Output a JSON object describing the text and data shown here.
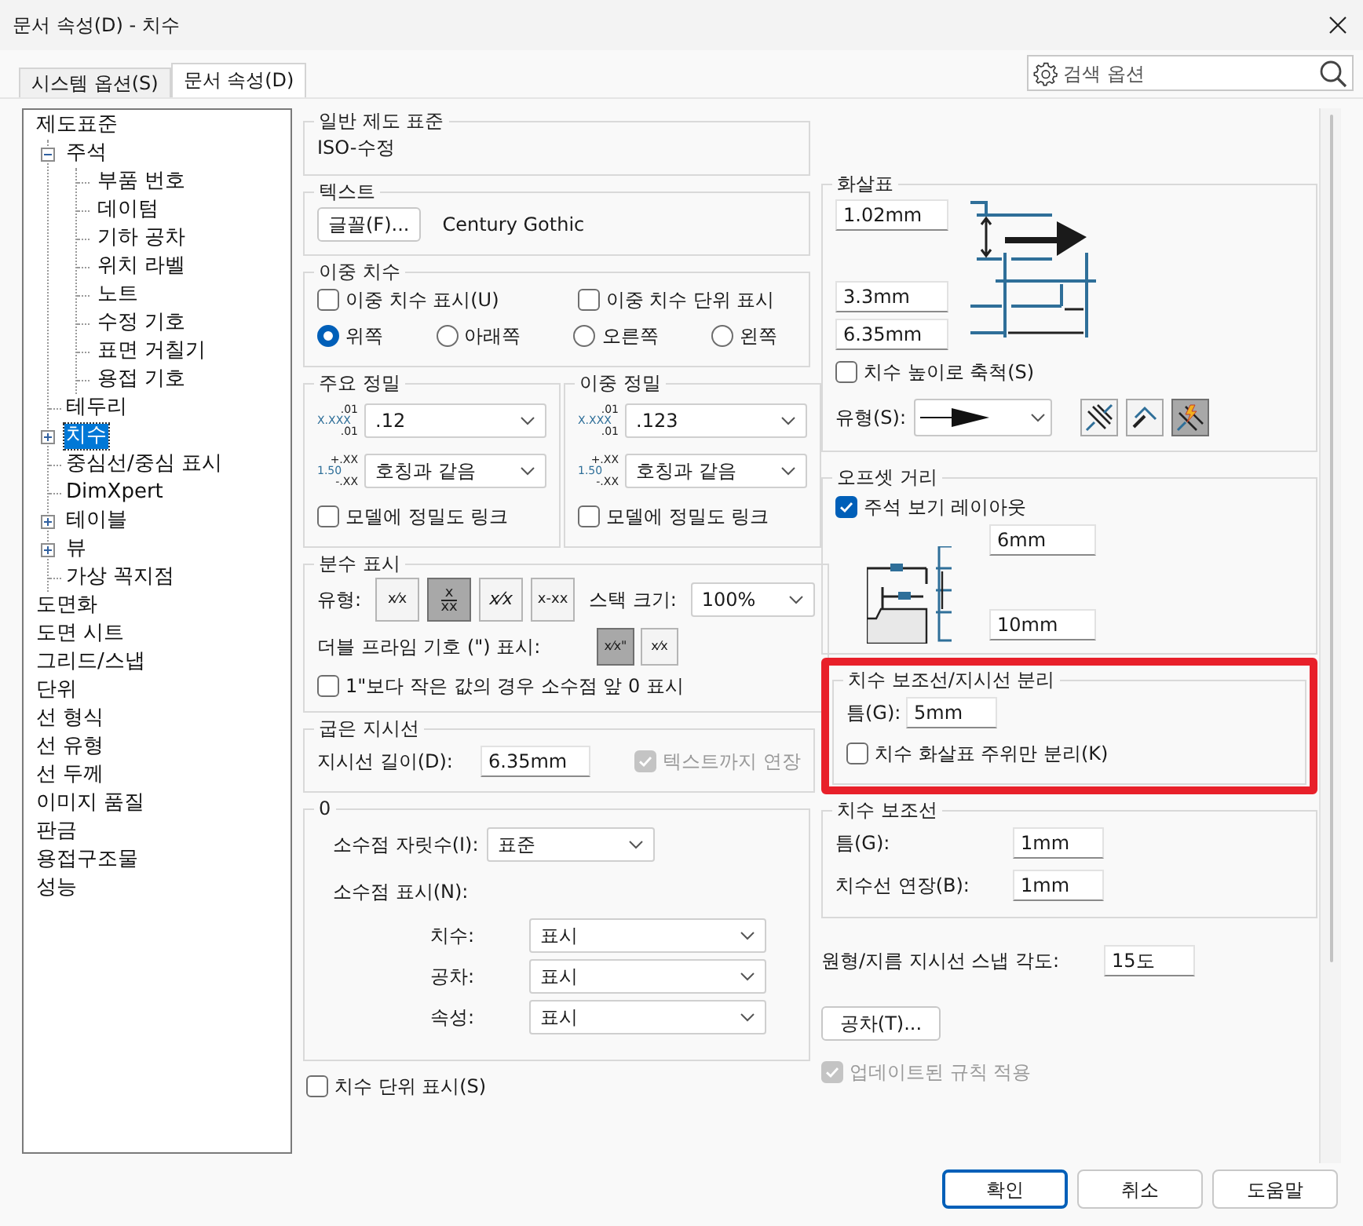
{
  "window": {
    "title": "문서 속성(D) - 치수"
  },
  "tabs": [
    {
      "label": "시스템 옵션(S)",
      "selected": false
    },
    {
      "label": "문서 속성(D)",
      "selected": true
    }
  ],
  "search": {
    "placeholder": "검색 옵션"
  },
  "tree": [
    {
      "label": "제도표준",
      "selected": false,
      "children": [
        {
          "label": "주석",
          "expanded": true,
          "selected": false,
          "children": [
            {
              "label": "부품 번호",
              "selected": false
            },
            {
              "label": "데이텀",
              "selected": false
            },
            {
              "label": "기하 공차",
              "selected": false
            },
            {
              "label": "위치 라벨",
              "selected": false
            },
            {
              "label": "노트",
              "selected": false
            },
            {
              "label": "수정 기호",
              "selected": false
            },
            {
              "label": "표면 거칠기",
              "selected": false
            },
            {
              "label": "용접 기호",
              "selected": false
            }
          ]
        },
        {
          "label": "테두리",
          "selected": false
        },
        {
          "label": "치수",
          "expanded": false,
          "selected": true
        },
        {
          "label": "중심선/중심 표시",
          "selected": false
        },
        {
          "label": "DimXpert",
          "selected": false
        },
        {
          "label": "테이블",
          "expanded": false,
          "selected": false
        },
        {
          "label": "뷰",
          "expanded": false,
          "selected": false
        },
        {
          "label": "가상 꼭지점",
          "selected": false
        }
      ]
    },
    {
      "label": "도면화",
      "selected": false
    },
    {
      "label": "도면 시트",
      "selected": false
    },
    {
      "label": "그리드/스냅",
      "selected": false
    },
    {
      "label": "단위",
      "selected": false
    },
    {
      "label": "선 형식",
      "selected": false
    },
    {
      "label": "선 유형",
      "selected": false
    },
    {
      "label": "선 두께",
      "selected": false
    },
    {
      "label": "이미지 품질",
      "selected": false
    },
    {
      "label": "판금",
      "selected": false
    },
    {
      "label": "용접구조물",
      "selected": false
    },
    {
      "label": "성능",
      "selected": false
    }
  ],
  "general_standard": {
    "legend": "일반 제도 표준",
    "value": "ISO-수정"
  },
  "text": {
    "legend": "텍스트",
    "font_button": "글꼴(F)...",
    "font_name": "Century Gothic"
  },
  "dual_dimension": {
    "legend": "이중 치수",
    "checkboxes": [
      {
        "label": "이중 치수 표시(U)",
        "checked": false
      },
      {
        "label": "이중 치수 단위 표시",
        "checked": false
      }
    ],
    "radios": [
      {
        "label": "위쪽",
        "selected": true
      },
      {
        "label": "아래쪽",
        "selected": false
      },
      {
        "label": "오른쪽",
        "selected": false
      },
      {
        "label": "왼쪽",
        "selected": false
      }
    ]
  },
  "precision_groups": [
    {
      "legend": "주요 정밀",
      "value_icon": [
        ".01",
        "X.XXX",
        ".01"
      ],
      "value": ".12",
      "tolerance_icon": [
        "+.XX",
        "1.50",
        "-.XX"
      ],
      "tolerance": "호칭과 같음",
      "link": {
        "label": "모델에 정밀도 링크",
        "checked": false
      }
    },
    {
      "legend": "이중 정밀",
      "value_icon": [
        ".01",
        "X.XXX",
        ".01"
      ],
      "value": ".123",
      "tolerance_icon": [
        "+.XX",
        "1.50",
        "-.XX"
      ],
      "tolerance": "호칭과 같음",
      "link": {
        "label": "모델에 정밀도 링크",
        "checked": false
      }
    }
  ],
  "fraction": {
    "legend": "분수 표시",
    "style_label": "유형:",
    "styles": [
      {
        "kind": "inline",
        "label": "x⁄x",
        "selected": false
      },
      {
        "kind": "stacked",
        "top": "x",
        "bottom": "xx",
        "selected": true
      },
      {
        "kind": "diagonal",
        "label": "x⁄x",
        "selected": false
      },
      {
        "kind": "inline",
        "label": "x-xx",
        "selected": false
      }
    ],
    "stack_label": "스택 크기:",
    "stack_size": "100%",
    "prime_label": "더블 프라임 기호 (\") 표시:",
    "prime_styles": [
      {
        "label": "x⁄x\"",
        "selected": true
      },
      {
        "label": "x⁄x",
        "selected": false
      }
    ],
    "leading_zero": {
      "label": "1\"보다 작은 값의 경우 소수점 앞 0 표시",
      "checked": false
    }
  },
  "bent_leader": {
    "legend": "굽은 지시선",
    "length_label": "지시선 길이(D):",
    "length": "6.35mm",
    "extend": {
      "label": "텍스트까지 연장",
      "checked": true,
      "disabled": true
    }
  },
  "zero_group": {
    "legend": "0",
    "places_label": "소수점 자릿수(I):",
    "places": "표준",
    "display_label": "소수점 표시(N):",
    "rows": [
      {
        "label": "치수:",
        "value": "표시"
      },
      {
        "label": "공차:",
        "value": "표시"
      },
      {
        "label": "속성:",
        "value": "표시"
      }
    ]
  },
  "unit_display": {
    "label": "치수 단위 표시(S)",
    "checked": false
  },
  "arrows": {
    "legend": "화살표",
    "sizes": [
      "1.02mm",
      "3.3mm",
      "6.35mm"
    ],
    "scale": {
      "label": "치수 높이로 축척(S)",
      "checked": false
    },
    "style_label": "유형(S):",
    "placements": [
      {
        "kind": "inside",
        "selected": false
      },
      {
        "kind": "outside",
        "selected": false
      },
      {
        "kind": "smart",
        "selected": true
      }
    ]
  },
  "offset": {
    "legend": "오프셋 거리",
    "layout": {
      "label": "주석 보기 레이아웃",
      "checked": true
    },
    "values": [
      "6mm",
      "10mm"
    ]
  },
  "break": {
    "legend": "치수 보조선/지시선 분리",
    "highlighted": true,
    "gap_label": "틈(G):",
    "gap": "5mm",
    "only_arrows": {
      "label": "치수 화살표 주위만 분리(K)",
      "checked": false
    }
  },
  "extension_lines": {
    "legend": "치수 보조선",
    "gap_label": "틈(G):",
    "gap": "1mm",
    "extend_label": "치수선 연장(B):",
    "extend": "1mm"
  },
  "snap_angle": {
    "label": "원형/지름 지시선 스냅 각도:",
    "value": "15도"
  },
  "tolerance_button": "공차(T)...",
  "apply_rules": {
    "label": "업데이트된 규칙 적용",
    "checked": true,
    "disabled": true
  },
  "buttons": [
    {
      "label": "확인",
      "default": true
    },
    {
      "label": "취소",
      "default": false
    },
    {
      "label": "도움말",
      "default": false
    }
  ]
}
